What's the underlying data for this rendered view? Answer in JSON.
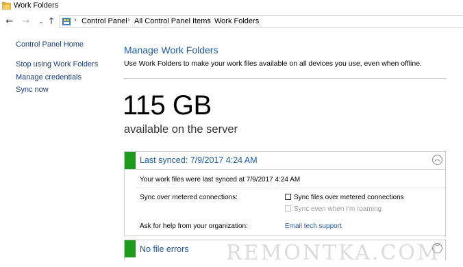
{
  "window": {
    "title": "Work Folders",
    "icon": "work-folders-icon"
  },
  "nav": {
    "back_icon": "back-arrow-icon",
    "forward_icon": "forward-arrow-icon",
    "recent_icon": "chevron-down-icon",
    "up_icon": "up-arrow-icon",
    "breadcrumbs": [
      "Control Panel",
      "All Control Panel Items",
      "Work Folders"
    ]
  },
  "sidebar": {
    "home": "Control Panel Home",
    "items": [
      "Stop using Work Folders",
      "Manage credentials",
      "Sync now"
    ]
  },
  "main": {
    "title": "Manage Work Folders",
    "description": "Use Work Folders to make your work files available on all devices you use, even when offline.",
    "storage_value": "115 GB",
    "storage_caption": "available on the server"
  },
  "sync_panel": {
    "status_color": "#1b9a1b",
    "header": "Last synced: 7/9/2017 4:24 AM",
    "collapse_icon": "chevron-up-icon",
    "detail": "Your work files were last synced at 7/9/2017 4:24 AM",
    "metered_label": "Sync over metered connections:",
    "metered_option": "Sync files over metered connections",
    "roaming_option": "Sync even when I'm roaming",
    "help_label": "Ask for help from your organization:",
    "help_link": "Email tech support"
  },
  "errors_panel": {
    "status_color": "#1b9a1b",
    "header": "No file errors",
    "expand_icon": "chevron-down-icon"
  },
  "watermark": "REMONTKA.COM"
}
